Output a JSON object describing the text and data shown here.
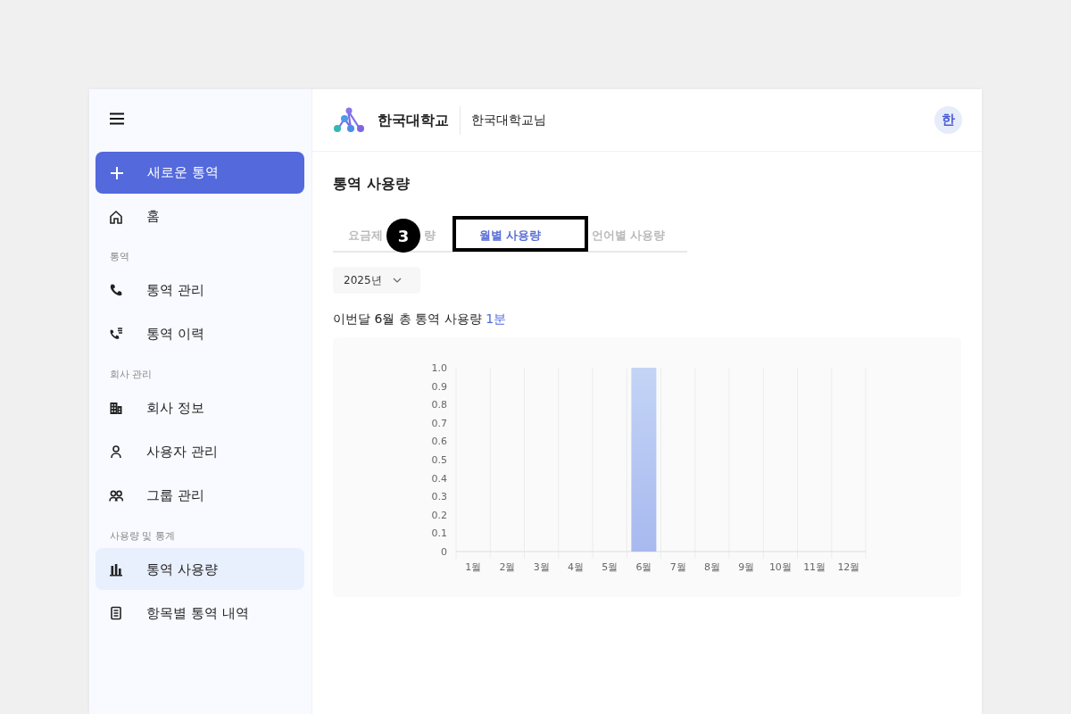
{
  "header": {
    "org_name": "한국대학교",
    "user_name": "한국대학교님",
    "avatar": "한"
  },
  "sidebar": {
    "new_button": "새로운 통역",
    "items": [
      {
        "kind": "item",
        "label": "홈",
        "selected": false
      },
      {
        "kind": "section",
        "label": "통역"
      },
      {
        "kind": "item",
        "label": "통역 관리",
        "selected": false
      },
      {
        "kind": "item",
        "label": "통역 이력",
        "selected": false
      },
      {
        "kind": "section",
        "label": "회사 관리"
      },
      {
        "kind": "item",
        "label": "회사 정보",
        "selected": false
      },
      {
        "kind": "item",
        "label": "사용자 관리",
        "selected": false
      },
      {
        "kind": "item",
        "label": "그룹 관리",
        "selected": false
      },
      {
        "kind": "section",
        "label": "사용량 및 통계"
      },
      {
        "kind": "item",
        "label": "통역 사용량",
        "selected": true
      },
      {
        "kind": "item",
        "label": "항목별 통역 내역",
        "selected": false
      }
    ]
  },
  "page_title": "통역 사용량",
  "tabs": [
    {
      "label_parts": [
        "요금제",
        "량"
      ],
      "selected": false,
      "highlighted": false
    },
    {
      "label_parts": [
        "월별 사용량"
      ],
      "selected": true,
      "highlighted": true
    },
    {
      "label_parts": [
        "언어별 사용량"
      ],
      "selected": false,
      "highlighted": false
    }
  ],
  "step_marker": "3",
  "year_select": "2025년",
  "summary": {
    "text": "이번달 6월 총 통역 사용량",
    "value": "1분"
  },
  "chart_data": {
    "type": "bar",
    "categories": [
      "1월",
      "2월",
      "3월",
      "4월",
      "5월",
      "6월",
      "7월",
      "8월",
      "9월",
      "10월",
      "11월",
      "12월"
    ],
    "values": [
      0,
      0,
      0,
      0,
      0,
      1,
      0,
      0,
      0,
      0,
      0,
      0
    ],
    "ylim": [
      0,
      1
    ],
    "yticks": [
      0,
      0.1,
      0.2,
      0.3,
      0.4,
      0.5,
      0.6,
      0.7,
      0.8,
      0.9,
      {
        "value": 1,
        "label": "1.0"
      }
    ]
  }
}
